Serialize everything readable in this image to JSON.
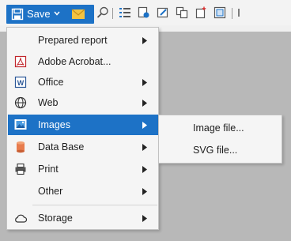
{
  "toolbar": {
    "save_label": "Save",
    "accent": "#1d72c6",
    "icons": [
      "save-icon",
      "chevron-down-icon",
      "email-icon",
      "find-icon",
      "outline-icon",
      "design-icon",
      "edit-icon",
      "copy-icon",
      "new-page-icon",
      "select-icon",
      "separator"
    ]
  },
  "menu": {
    "items": [
      {
        "label": "Prepared report",
        "icon": null,
        "has_submenu": true
      },
      {
        "label": "Adobe Acrobat...",
        "icon": "pdf-icon",
        "has_submenu": false
      },
      {
        "label": "Office",
        "icon": "word-icon",
        "has_submenu": true
      },
      {
        "label": "Web",
        "icon": "globe-icon",
        "has_submenu": true
      },
      {
        "label": "Images",
        "icon": "image-icon",
        "has_submenu": true,
        "active": true
      },
      {
        "label": "Data Base",
        "icon": "database-icon",
        "has_submenu": true
      },
      {
        "label": "Print",
        "icon": "printer-icon",
        "has_submenu": true
      },
      {
        "label": "Other",
        "icon": null,
        "has_submenu": true
      },
      {
        "label": "Storage",
        "icon": "cloud-icon",
        "has_submenu": true
      }
    ]
  },
  "submenu": {
    "items": [
      {
        "label": "Image file..."
      },
      {
        "label": "SVG file..."
      }
    ]
  }
}
